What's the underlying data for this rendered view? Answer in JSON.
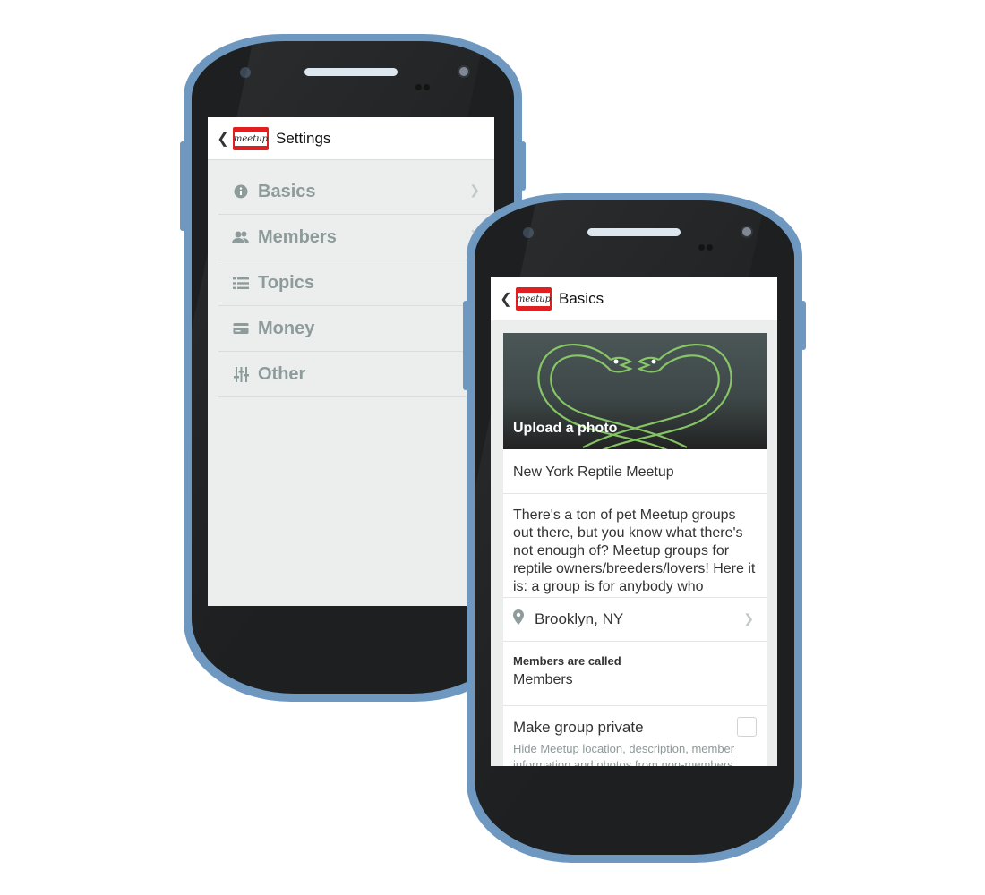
{
  "settings_screen": {
    "title": "Settings",
    "logo_text": "meetup",
    "items": [
      {
        "label": "Basics",
        "icon": "info-icon"
      },
      {
        "label": "Members",
        "icon": "people-icon"
      },
      {
        "label": "Topics",
        "icon": "list-icon"
      },
      {
        "label": "Money",
        "icon": "card-icon"
      },
      {
        "label": "Other",
        "icon": "sliders-icon"
      }
    ]
  },
  "basics_screen": {
    "title": "Basics",
    "logo_text": "meetup",
    "photo": {
      "upload_label": "Upload a photo"
    },
    "group_name": "New York Reptile Meetup",
    "description": "There's a ton of pet Meetup groups out there, but you know what there's not enough of? Meetup groups for reptile owners/breeders/lovers! Here it is: a group is for anybody who",
    "location": "Brooklyn, NY",
    "members_called": {
      "label": "Members are called",
      "value": "Members"
    },
    "private": {
      "label": "Make group private",
      "hint": "Hide Meetup location, description, member information and photos from non-members.",
      "checked": false
    }
  },
  "colors": {
    "phone_frame": "#6f98c0",
    "phone_body": "#1d1f21",
    "brand_red": "#e02020",
    "muted_label": "#8e9b9b"
  }
}
